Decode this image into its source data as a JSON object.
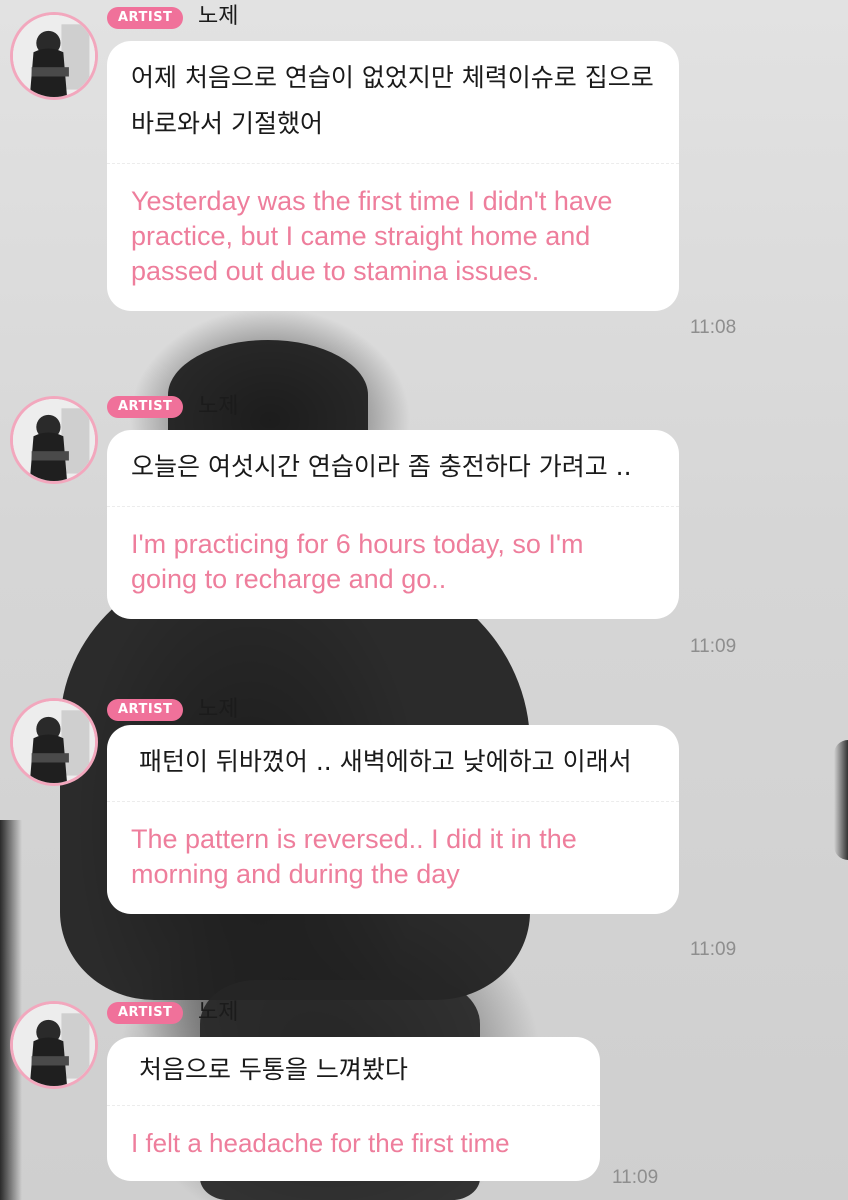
{
  "messages": [
    {
      "badge": "ARTIST",
      "sender": "노제",
      "korean": "어제 처음으로 연습이 없었지만 체력이슈로 집으로 바로와서 기절했어",
      "english": "Yesterday was the first time I didn't have practice, but I came straight home and passed out due to stamina issues.",
      "time": "11:08"
    },
    {
      "badge": "ARTIST",
      "sender": "노제",
      "korean": "오늘은 여섯시간 연습이라 좀 충전하다 가려고 ..",
      "english": "I'm practicing for 6 hours today, so I'm going to recharge and go..",
      "time": "11:09"
    },
    {
      "badge": "ARTIST",
      "sender": "노제",
      "korean": " 패턴이 뒤바꼈어 .. 새벽에하고 낮에하고 이래서",
      "english": "The pattern is reversed.. I did it in the morning and during the day",
      "time": "11:09"
    },
    {
      "badge": "ARTIST",
      "sender": "노제",
      "korean": " 처음으로 두통을 느껴봤다",
      "english": "I felt a headache for the first time",
      "time": "11:09"
    }
  ],
  "colors": {
    "badge": "#f0719a",
    "translation": "#ee7e9c",
    "avatar_ring": "#f2a7bd",
    "timestamp": "#8e8e8e"
  },
  "icons": {
    "avatar": "profile-photo-icon"
  }
}
